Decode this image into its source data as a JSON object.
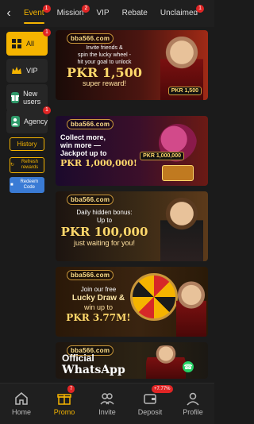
{
  "header": {
    "tabs": [
      {
        "label": "Event",
        "badge": "1",
        "active": true
      },
      {
        "label": "Mission",
        "badge": "2",
        "active": false
      },
      {
        "label": "VIP",
        "badge": "",
        "active": false
      },
      {
        "label": "Rebate",
        "badge": "",
        "active": false
      },
      {
        "label": "Unclaimed",
        "badge": "1",
        "active": false
      }
    ]
  },
  "sidebar": {
    "items": [
      {
        "label": "All",
        "icon": "grid-icon",
        "badge": "1",
        "active": true
      },
      {
        "label": "VIP",
        "icon": "crown-icon",
        "badge": "",
        "active": false
      },
      {
        "label": "New users",
        "icon": "gift-icon",
        "badge": "",
        "active": false
      },
      {
        "label": "Agency",
        "icon": "agency-icon",
        "badge": "1",
        "active": false
      }
    ],
    "history_label": "History",
    "refresh_label": "Refresh rewards",
    "redeem_label": "Redeem Code"
  },
  "banners": [
    {
      "brand": "bba566.com",
      "lines": [
        "Invite friends &",
        "spin the lucky wheel -",
        "hit your goal to unlock"
      ],
      "big": "PKR 1,500",
      "sub": "super reward!",
      "tag": "PKR 1,500"
    },
    {
      "brand": "bba566.com",
      "lines": [
        "Collect more,",
        "win more —"
      ],
      "med": "Jackpot up to",
      "big": "PKR 1,000,000!",
      "tag": "PKR 1,000,000"
    },
    {
      "brand": "bba566.com",
      "lines": [
        "Daily hidden bonus:",
        "Up to"
      ],
      "big": "PKR 100,000",
      "sub": "just waiting for you!"
    },
    {
      "brand": "bba566.com",
      "lines": [
        "Join our free"
      ],
      "med": "Lucky Draw &",
      "sub": "win up to",
      "big": "PKR 3.77M!"
    },
    {
      "brand": "bba566.com",
      "med": "Official",
      "big": "WhatsApp"
    }
  ],
  "bottom_nav": {
    "items": [
      {
        "label": "Home",
        "icon": "home-icon",
        "badge": "",
        "active": false
      },
      {
        "label": "Promo",
        "icon": "gift-icon",
        "badge": "7",
        "active": true
      },
      {
        "label": "Invite",
        "icon": "people-icon",
        "badge": "",
        "active": false
      },
      {
        "label": "Deposit",
        "icon": "wallet-icon",
        "badge": "+7.77%",
        "active": false
      },
      {
        "label": "Profile",
        "icon": "person-icon",
        "badge": "",
        "active": false
      }
    ]
  },
  "colors": {
    "accent": "#f5b400",
    "badge": "#e02525",
    "background": "#1b1b1b"
  }
}
